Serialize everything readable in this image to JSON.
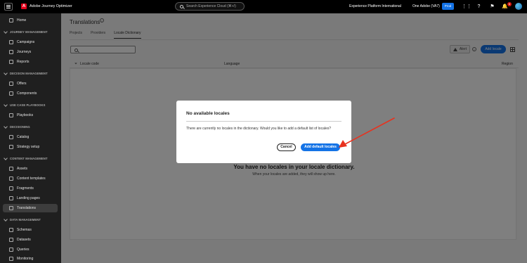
{
  "topbar": {
    "app_title": "Adobe Journey Optimizer",
    "search_placeholder": "Search Experience Cloud (⌘+/)",
    "sandbox": "Experience Platform International",
    "org": "One Adobe (VA7)",
    "env_badge": "Prod",
    "notification_count": "6"
  },
  "sidebar": {
    "home": "Home",
    "sections": [
      {
        "title": "JOURNEY MANAGEMENT",
        "items": [
          "Campaigns",
          "Journeys",
          "Reports"
        ]
      },
      {
        "title": "DECISION MANAGEMENT",
        "items": [
          "Offers",
          "Components"
        ]
      },
      {
        "title": "USE CASE PLAYBOOKS",
        "items": [
          "Playbooks"
        ]
      },
      {
        "title": "DECISIONING",
        "items": [
          "Catalog",
          "Strategy setup"
        ]
      },
      {
        "title": "CONTENT MANAGEMENT",
        "items": [
          "Assets",
          "Content templates",
          "Fragments",
          "Landing pages",
          "Translations"
        ]
      },
      {
        "title": "DATA MANAGEMENT",
        "items": [
          "Schemas",
          "Datasets",
          "Queries",
          "Monitoring"
        ]
      }
    ],
    "active_item": "Translations"
  },
  "main": {
    "title": "Translations",
    "tabs": [
      {
        "label": "Projects",
        "active": false
      },
      {
        "label": "Providers",
        "active": false
      },
      {
        "label": "Locale Dictionary",
        "active": true
      }
    ],
    "search_placeholder": "",
    "alert_label": "Alert",
    "add_locale_label": "Add locale",
    "columns": [
      "Locale code",
      "Language",
      "Region"
    ],
    "empty_title": "You have no locales in your locale dictionary.",
    "empty_sub": "When your locales are added, they will show up here."
  },
  "dialog": {
    "title": "No available locales",
    "body": "There are currently no locales in the dictionary. Would you like to add a default list of locales?",
    "cancel_label": "Cancel",
    "confirm_label": "Add default locales"
  },
  "colors": {
    "accent": "#1473e6",
    "annotation_arrow": "#e8321e",
    "sidebar_bg": "#1f1f1f",
    "topbar_bg": "#000000"
  }
}
